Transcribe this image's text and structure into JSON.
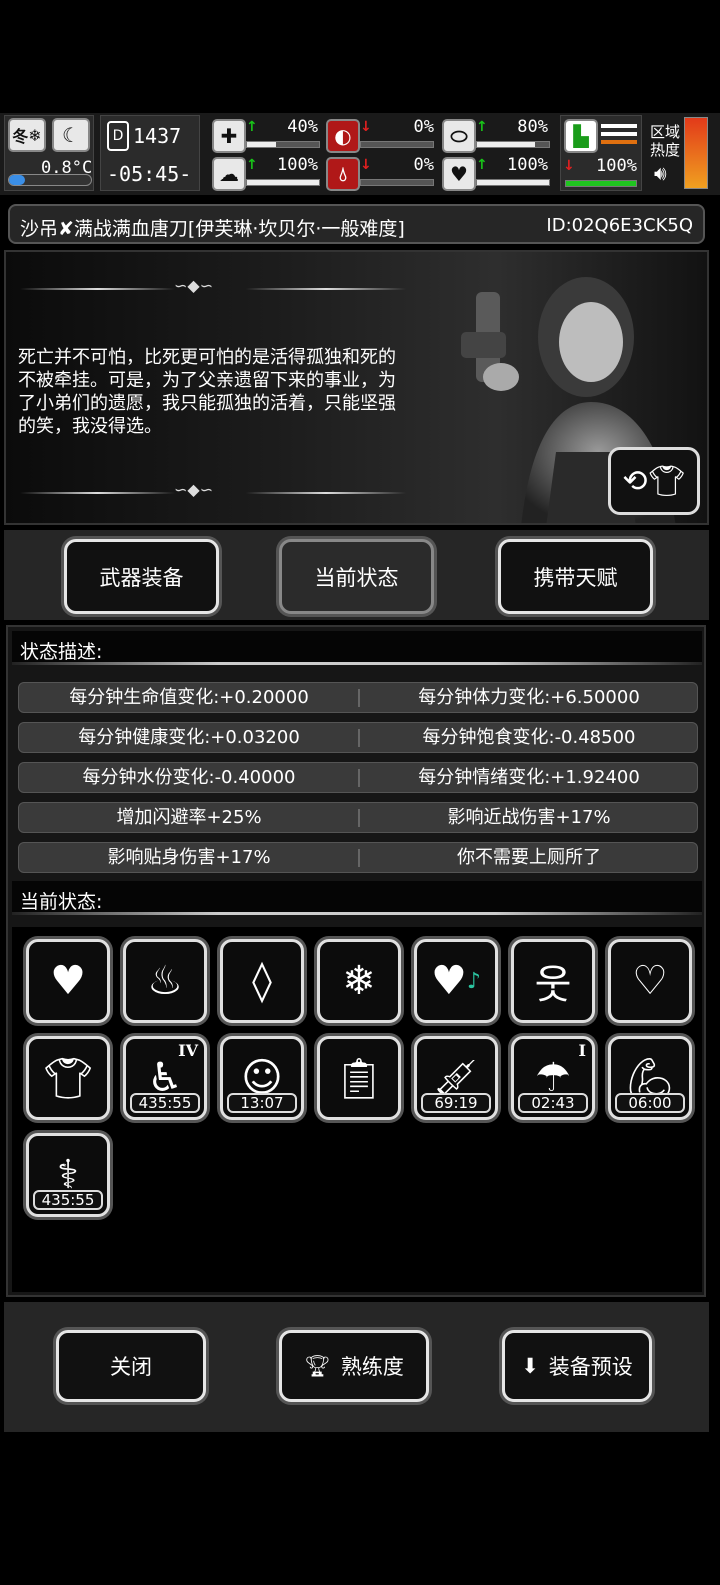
{
  "status_bar": {
    "season": "冬",
    "temperature": "0.8°C",
    "day_counter": "1437",
    "time": "-05:45-",
    "health_pct": "40%",
    "health_level": 0.4,
    "stomach_pct": "0%",
    "stomach_level": 0.0,
    "pill_pct": "80%",
    "pill_level": 0.8,
    "brain_pct": "100%",
    "brain_level": 1.0,
    "water_pct": "0%",
    "water_level": 0.0,
    "heart_pct": "100%",
    "heart_level": 1.0,
    "stamina_pct": "100%",
    "stamina_level": 1.0,
    "region_label_1": "区域",
    "region_label_2": "热度"
  },
  "title": {
    "text": "沙吊✘满战满血唐刀[伊芙琳·坎贝尔·一般难度]",
    "id": "ID:02Q6E3CK5Q"
  },
  "portrait": {
    "quote": "死亡并不可怕，比死更可怕的是活得孤独和死的不被牵挂。可是，为了父亲遗留下来的事业，为了小弟们的遗愿，我只能孤独的活着，只能坚强的笑，我没得选。"
  },
  "tabs": [
    {
      "label": "武器装备"
    },
    {
      "label": "当前状态"
    },
    {
      "label": "携带天赋"
    }
  ],
  "status_desc": {
    "header": "状态描述:",
    "rows": [
      [
        "每分钟生命值变化:+0.20000",
        "每分钟体力变化:+6.50000"
      ],
      [
        "每分钟健康变化:+0.03200",
        "每分钟饱食变化:-0.48500"
      ],
      [
        "每分钟水份变化:-0.40000",
        "每分钟情绪变化:+1.92400"
      ],
      [
        "增加闪避率+25%",
        "影响近战伤害+17%"
      ],
      [
        "影响贴身伤害+17%",
        "你不需要上厕所了"
      ]
    ]
  },
  "current_status": {
    "header": "当前状态:",
    "timers": {
      "t1": "435:55",
      "t2": "13:07",
      "t3": "69:19",
      "t4": "02:43",
      "t5": "06:00",
      "t6": "435:55"
    },
    "roman_1": "IV",
    "roman_2": "I"
  },
  "bottom": {
    "close": "关闭",
    "proficiency": "熟练度",
    "preset": "装备预设"
  }
}
